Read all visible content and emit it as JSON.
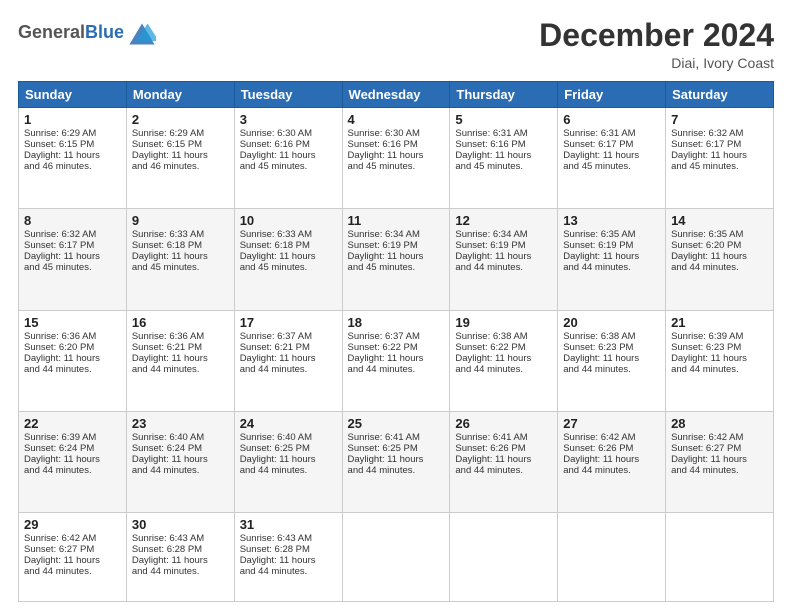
{
  "header": {
    "logo_general": "General",
    "logo_blue": "Blue",
    "month": "December 2024",
    "location": "Diai, Ivory Coast"
  },
  "days_of_week": [
    "Sunday",
    "Monday",
    "Tuesday",
    "Wednesday",
    "Thursday",
    "Friday",
    "Saturday"
  ],
  "weeks": [
    [
      {
        "day": 1,
        "lines": [
          "Sunrise: 6:29 AM",
          "Sunset: 6:15 PM",
          "Daylight: 11 hours",
          "and 46 minutes."
        ]
      },
      {
        "day": 2,
        "lines": [
          "Sunrise: 6:29 AM",
          "Sunset: 6:15 PM",
          "Daylight: 11 hours",
          "and 46 minutes."
        ]
      },
      {
        "day": 3,
        "lines": [
          "Sunrise: 6:30 AM",
          "Sunset: 6:16 PM",
          "Daylight: 11 hours",
          "and 45 minutes."
        ]
      },
      {
        "day": 4,
        "lines": [
          "Sunrise: 6:30 AM",
          "Sunset: 6:16 PM",
          "Daylight: 11 hours",
          "and 45 minutes."
        ]
      },
      {
        "day": 5,
        "lines": [
          "Sunrise: 6:31 AM",
          "Sunset: 6:16 PM",
          "Daylight: 11 hours",
          "and 45 minutes."
        ]
      },
      {
        "day": 6,
        "lines": [
          "Sunrise: 6:31 AM",
          "Sunset: 6:17 PM",
          "Daylight: 11 hours",
          "and 45 minutes."
        ]
      },
      {
        "day": 7,
        "lines": [
          "Sunrise: 6:32 AM",
          "Sunset: 6:17 PM",
          "Daylight: 11 hours",
          "and 45 minutes."
        ]
      }
    ],
    [
      {
        "day": 8,
        "lines": [
          "Sunrise: 6:32 AM",
          "Sunset: 6:17 PM",
          "Daylight: 11 hours",
          "and 45 minutes."
        ]
      },
      {
        "day": 9,
        "lines": [
          "Sunrise: 6:33 AM",
          "Sunset: 6:18 PM",
          "Daylight: 11 hours",
          "and 45 minutes."
        ]
      },
      {
        "day": 10,
        "lines": [
          "Sunrise: 6:33 AM",
          "Sunset: 6:18 PM",
          "Daylight: 11 hours",
          "and 45 minutes."
        ]
      },
      {
        "day": 11,
        "lines": [
          "Sunrise: 6:34 AM",
          "Sunset: 6:19 PM",
          "Daylight: 11 hours",
          "and 45 minutes."
        ]
      },
      {
        "day": 12,
        "lines": [
          "Sunrise: 6:34 AM",
          "Sunset: 6:19 PM",
          "Daylight: 11 hours",
          "and 44 minutes."
        ]
      },
      {
        "day": 13,
        "lines": [
          "Sunrise: 6:35 AM",
          "Sunset: 6:19 PM",
          "Daylight: 11 hours",
          "and 44 minutes."
        ]
      },
      {
        "day": 14,
        "lines": [
          "Sunrise: 6:35 AM",
          "Sunset: 6:20 PM",
          "Daylight: 11 hours",
          "and 44 minutes."
        ]
      }
    ],
    [
      {
        "day": 15,
        "lines": [
          "Sunrise: 6:36 AM",
          "Sunset: 6:20 PM",
          "Daylight: 11 hours",
          "and 44 minutes."
        ]
      },
      {
        "day": 16,
        "lines": [
          "Sunrise: 6:36 AM",
          "Sunset: 6:21 PM",
          "Daylight: 11 hours",
          "and 44 minutes."
        ]
      },
      {
        "day": 17,
        "lines": [
          "Sunrise: 6:37 AM",
          "Sunset: 6:21 PM",
          "Daylight: 11 hours",
          "and 44 minutes."
        ]
      },
      {
        "day": 18,
        "lines": [
          "Sunrise: 6:37 AM",
          "Sunset: 6:22 PM",
          "Daylight: 11 hours",
          "and 44 minutes."
        ]
      },
      {
        "day": 19,
        "lines": [
          "Sunrise: 6:38 AM",
          "Sunset: 6:22 PM",
          "Daylight: 11 hours",
          "and 44 minutes."
        ]
      },
      {
        "day": 20,
        "lines": [
          "Sunrise: 6:38 AM",
          "Sunset: 6:23 PM",
          "Daylight: 11 hours",
          "and 44 minutes."
        ]
      },
      {
        "day": 21,
        "lines": [
          "Sunrise: 6:39 AM",
          "Sunset: 6:23 PM",
          "Daylight: 11 hours",
          "and 44 minutes."
        ]
      }
    ],
    [
      {
        "day": 22,
        "lines": [
          "Sunrise: 6:39 AM",
          "Sunset: 6:24 PM",
          "Daylight: 11 hours",
          "and 44 minutes."
        ]
      },
      {
        "day": 23,
        "lines": [
          "Sunrise: 6:40 AM",
          "Sunset: 6:24 PM",
          "Daylight: 11 hours",
          "and 44 minutes."
        ]
      },
      {
        "day": 24,
        "lines": [
          "Sunrise: 6:40 AM",
          "Sunset: 6:25 PM",
          "Daylight: 11 hours",
          "and 44 minutes."
        ]
      },
      {
        "day": 25,
        "lines": [
          "Sunrise: 6:41 AM",
          "Sunset: 6:25 PM",
          "Daylight: 11 hours",
          "and 44 minutes."
        ]
      },
      {
        "day": 26,
        "lines": [
          "Sunrise: 6:41 AM",
          "Sunset: 6:26 PM",
          "Daylight: 11 hours",
          "and 44 minutes."
        ]
      },
      {
        "day": 27,
        "lines": [
          "Sunrise: 6:42 AM",
          "Sunset: 6:26 PM",
          "Daylight: 11 hours",
          "and 44 minutes."
        ]
      },
      {
        "day": 28,
        "lines": [
          "Sunrise: 6:42 AM",
          "Sunset: 6:27 PM",
          "Daylight: 11 hours",
          "and 44 minutes."
        ]
      }
    ],
    [
      {
        "day": 29,
        "lines": [
          "Sunrise: 6:42 AM",
          "Sunset: 6:27 PM",
          "Daylight: 11 hours",
          "and 44 minutes."
        ]
      },
      {
        "day": 30,
        "lines": [
          "Sunrise: 6:43 AM",
          "Sunset: 6:28 PM",
          "Daylight: 11 hours",
          "and 44 minutes."
        ]
      },
      {
        "day": 31,
        "lines": [
          "Sunrise: 6:43 AM",
          "Sunset: 6:28 PM",
          "Daylight: 11 hours",
          "and 44 minutes."
        ]
      },
      null,
      null,
      null,
      null
    ]
  ]
}
